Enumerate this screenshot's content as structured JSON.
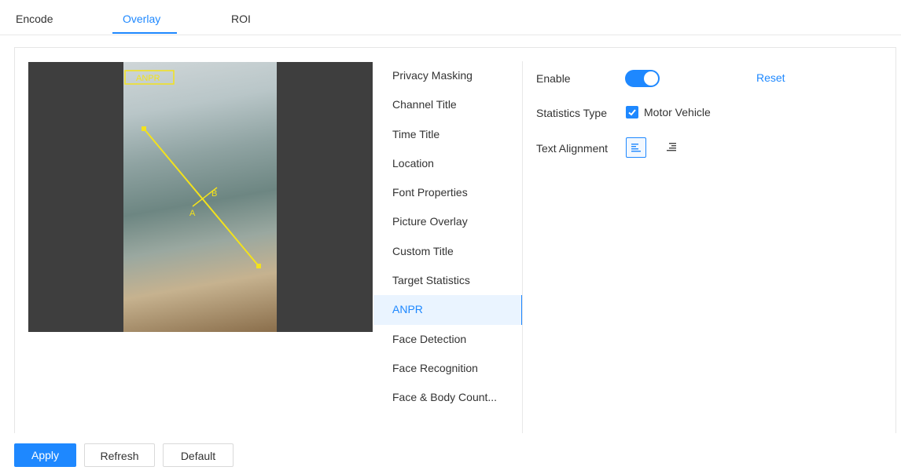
{
  "tabs": [
    {
      "label": "Encode"
    },
    {
      "label": "Overlay"
    },
    {
      "label": "ROI"
    }
  ],
  "video": {
    "overlay_box_label": "ANPR",
    "point_a": "A",
    "point_b": "B"
  },
  "menu": {
    "items": [
      {
        "label": "Privacy Masking"
      },
      {
        "label": "Channel Title"
      },
      {
        "label": "Time Title"
      },
      {
        "label": "Location"
      },
      {
        "label": "Font Properties"
      },
      {
        "label": "Picture Overlay"
      },
      {
        "label": "Custom Title"
      },
      {
        "label": "Target Statistics"
      },
      {
        "label": "ANPR"
      },
      {
        "label": "Face Detection"
      },
      {
        "label": "Face Recognition"
      },
      {
        "label": "Face & Body Count..."
      }
    ]
  },
  "settings": {
    "enable_label": "Enable",
    "enable_on": true,
    "reset_label": "Reset",
    "statistics_type_label": "Statistics Type",
    "motor_vehicle_label": "Motor Vehicle",
    "motor_vehicle_checked": true,
    "text_alignment_label": "Text Alignment",
    "alignment_options": [
      "align-left-icon",
      "align-right-icon"
    ],
    "alignment_selected": "align-left-icon"
  },
  "footer": {
    "apply_label": "Apply",
    "refresh_label": "Refresh",
    "default_label": "Default"
  },
  "colors": {
    "accent": "#1e88ff",
    "overlay_line": "#f3e21c"
  }
}
